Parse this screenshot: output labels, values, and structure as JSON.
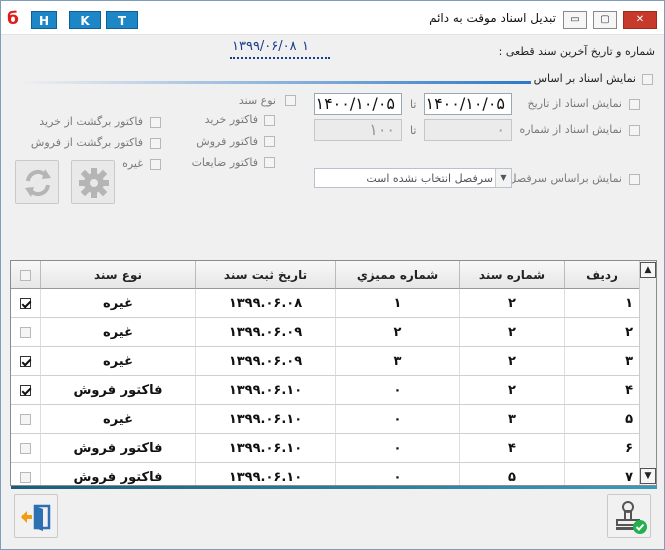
{
  "titlebar": {
    "title": "تبدیل اسناد موقت به دائم",
    "logo": "б",
    "hotkeys": [
      "H",
      "K",
      "T"
    ],
    "controls": {
      "minimize": "▭",
      "maximize": "▢",
      "close": "✕"
    }
  },
  "header": {
    "last_doc_label": "شماره و تاریخ آخرین سند قطعی :",
    "last_doc_number": "۱",
    "last_doc_date": "۱۳۹۹/۰۶/۰۸"
  },
  "filter": {
    "show_by_label": "نمایش اسناد بر اساس",
    "from_date_label": "نمایش اسناد از تاریخ",
    "from_number_label": "نمایش اسناد از شماره",
    "to_label": "تا",
    "date_from": "۱۴۰۰/۱۰/۰۵",
    "date_to": "۱۴۰۰/۱۰/۰۵",
    "num_from": "۰",
    "num_to": "۱۰۰",
    "doc_type_label": "نوع سند",
    "types": {
      "purchase_invoice": "فاکتور خرید",
      "sales_invoice": "فاکتور فروش",
      "waste_invoice": "فاکتور ضایعات",
      "purchase_return": "فاکتور برگشت از خرید",
      "sales_return": "فاکتور برگشت از فروش",
      "other": "غیره"
    },
    "header_filter_label": "نمایش براساس سرفصل",
    "header_combo_value": "سرفصل انتخاب نشده است"
  },
  "table": {
    "columns": [
      "ردیف",
      "شماره سند",
      "شماره مميزي",
      "تاریخ ثبت سند",
      "نوع سند"
    ],
    "rows": [
      {
        "row": "۱",
        "doc_no": "۲",
        "audit_no": "۱",
        "date": "۱۳۹۹.۰۶.۰۸",
        "type": "غیره",
        "checked": true
      },
      {
        "row": "۲",
        "doc_no": "۲",
        "audit_no": "۲",
        "date": "۱۳۹۹.۰۶.۰۹",
        "type": "غیره",
        "checked": false
      },
      {
        "row": "۳",
        "doc_no": "۲",
        "audit_no": "۳",
        "date": "۱۳۹۹.۰۶.۰۹",
        "type": "غیره",
        "checked": true
      },
      {
        "row": "۴",
        "doc_no": "۲",
        "audit_no": "۰",
        "date": "۱۳۹۹.۰۶.۱۰",
        "type": "فاکتور فروش",
        "checked": true
      },
      {
        "row": "۵",
        "doc_no": "۳",
        "audit_no": "۰",
        "date": "۱۳۹۹.۰۶.۱۰",
        "type": "غیره",
        "checked": false
      },
      {
        "row": "۶",
        "doc_no": "۴",
        "audit_no": "۰",
        "date": "۱۳۹۹.۰۶.۱۰",
        "type": "فاکتور فروش",
        "checked": false
      },
      {
        "row": "۷",
        "doc_no": "۵",
        "audit_no": "۰",
        "date": "۱۳۹۹.۰۶.۱۰",
        "type": "فاکتور فروش",
        "checked": false
      }
    ]
  },
  "scrollbar": {
    "up": "▲",
    "down": "▼"
  },
  "colors": {
    "accent": "#1c86c7",
    "close": "#c7392b",
    "separator": "#2e78c7"
  }
}
